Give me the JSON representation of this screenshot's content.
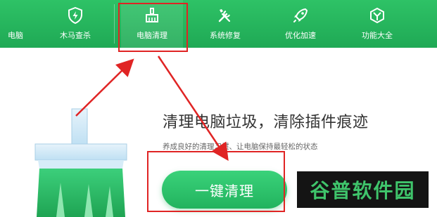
{
  "nav": {
    "items": [
      {
        "label": "电脑",
        "icon": "computer-icon"
      },
      {
        "label": "木马查杀",
        "icon": "shield-lightning-icon"
      },
      {
        "label": "电脑清理",
        "icon": "broom-icon"
      },
      {
        "label": "系统修复",
        "icon": "wrench-screwdriver-icon"
      },
      {
        "label": "优化加速",
        "icon": "rocket-icon"
      },
      {
        "label": "功能大全",
        "icon": "cube-icon"
      }
    ],
    "active_index": 2
  },
  "main": {
    "headline": "清理电脑垃圾，清除插件痕迹",
    "subline": "养成良好的清理习惯、让电脑保持最轻松的状态",
    "button_label": "一键清理"
  },
  "watermark": {
    "text": "谷普软件园"
  },
  "colors": {
    "accent": "#22b35e",
    "annotation": "#e02424",
    "watermark_bg": "#141414"
  }
}
